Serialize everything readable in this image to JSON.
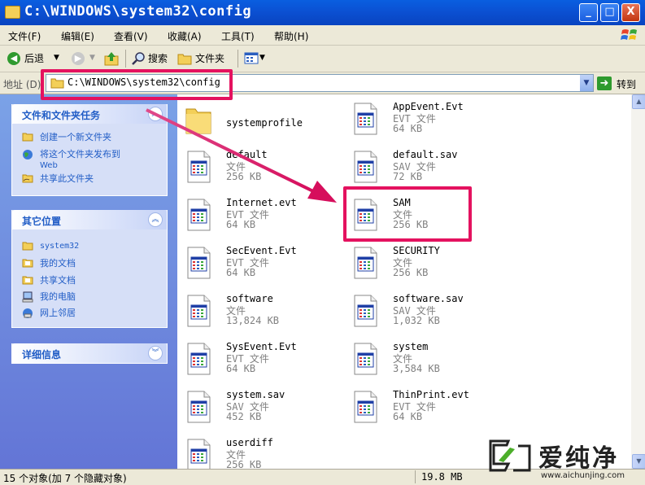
{
  "window": {
    "title": "C:\\WINDOWS\\system32\\config",
    "min_label": "_",
    "max_label": "□",
    "close_label": "X"
  },
  "menu": [
    "文件(F)",
    "编辑(E)",
    "查看(V)",
    "收藏(A)",
    "工具(T)",
    "帮助(H)"
  ],
  "toolbar": {
    "back_label": "后退",
    "search_label": "搜索",
    "folders_label": "文件夹"
  },
  "address": {
    "label": "地址 (D)",
    "value": "C:\\WINDOWS\\system32\\config",
    "go_label": "转到"
  },
  "sidebar": {
    "tasks": {
      "title": "文件和文件夹任务",
      "items": [
        "创建一个新文件夹",
        "将这个文件夹发布到",
        "Web",
        "共享此文件夹"
      ]
    },
    "places": {
      "title": "其它位置",
      "items": [
        "system32",
        "我的文档",
        "共享文档",
        "我的电脑",
        "网上邻居"
      ]
    },
    "details": {
      "title": "详细信息"
    }
  },
  "files": [
    {
      "name": "systemprofile",
      "type": "",
      "size": "",
      "icon": "folder-icon"
    },
    {
      "name": "AppEvent.Evt",
      "type": "EVT 文件",
      "size": "64 KB",
      "icon": "file-icon"
    },
    {
      "name": "default",
      "type": "文件",
      "size": "256 KB",
      "icon": "file-icon"
    },
    {
      "name": "default.sav",
      "type": "SAV 文件",
      "size": "72 KB",
      "icon": "file-icon"
    },
    {
      "name": "Internet.evt",
      "type": "EVT 文件",
      "size": "64 KB",
      "icon": "file-icon"
    },
    {
      "name": "SAM",
      "type": "文件",
      "size": "256 KB",
      "icon": "file-icon"
    },
    {
      "name": "SecEvent.Evt",
      "type": "EVT 文件",
      "size": "64 KB",
      "icon": "file-icon"
    },
    {
      "name": "SECURITY",
      "type": "文件",
      "size": "256 KB",
      "icon": "file-icon"
    },
    {
      "name": "software",
      "type": "文件",
      "size": "13,824 KB",
      "icon": "file-icon"
    },
    {
      "name": "software.sav",
      "type": "SAV 文件",
      "size": "1,032 KB",
      "icon": "file-icon"
    },
    {
      "name": "SysEvent.Evt",
      "type": "EVT 文件",
      "size": "64 KB",
      "icon": "file-icon"
    },
    {
      "name": "system",
      "type": "文件",
      "size": "3,584 KB",
      "icon": "file-icon"
    },
    {
      "name": "system.sav",
      "type": "SAV 文件",
      "size": "452 KB",
      "icon": "file-icon"
    },
    {
      "name": "ThinPrint.evt",
      "type": "EVT 文件",
      "size": "64 KB",
      "icon": "file-icon"
    },
    {
      "name": "userdiff",
      "type": "文件",
      "size": "256 KB",
      "icon": "file-icon"
    }
  ],
  "status": {
    "count": "15 个对象(加 7 个隐藏对象)",
    "size": "19.8 MB"
  },
  "annotation": {
    "color": "#e4125f"
  },
  "watermark": {
    "brand": "爱纯净",
    "url": "www.aichunjing.com"
  },
  "colors": {
    "titlebar": "#0a5fe0",
    "sidebar": "#6f8ddb",
    "panel_title": "#215dc6"
  }
}
